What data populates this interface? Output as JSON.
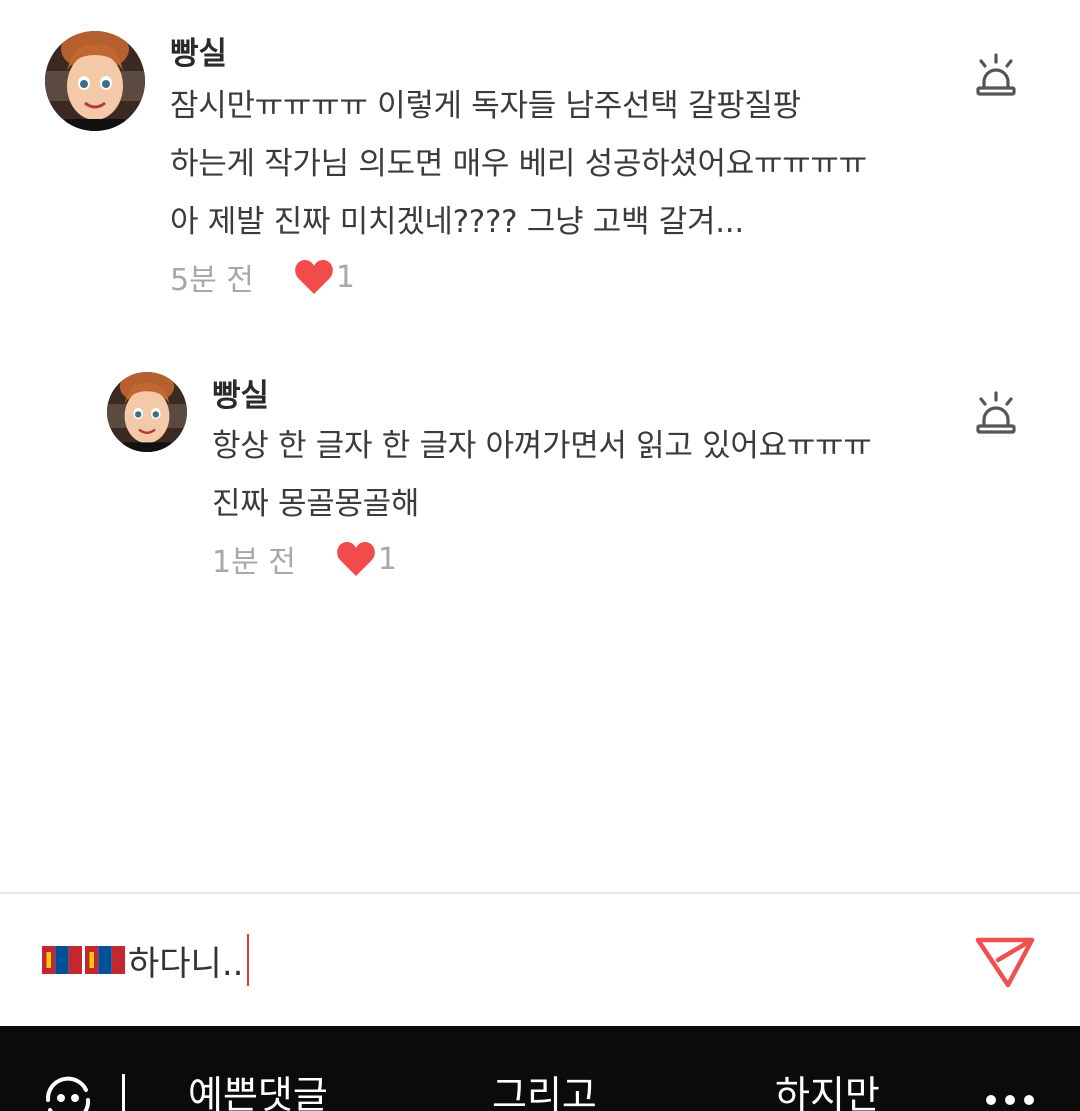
{
  "comments": [
    {
      "username": "빵실",
      "lines": [
        "잠시만ㅠㅠㅠㅠ 이렇게 독자들 남주선택 갈팡질팡",
        "하는게 작가님 의도면 매우 베리 성공하셨어요ㅠㅠㅠㅠ",
        "아 제발 진짜 미치겠네???? 그냥 고백 갈겨..."
      ],
      "time": "5분 전",
      "likes": "1"
    },
    {
      "username": "빵실",
      "lines": [
        "항상 한 글자 한 글자 아껴가면서 읽고 있어요ㅠㅠㅠ",
        "진짜 몽골몽골해"
      ],
      "time": "1분 전",
      "likes": "1"
    }
  ],
  "composer": {
    "input_text": "하다니..",
    "flag_emoji": "mongolia-flag"
  },
  "keyboard": {
    "suggestions": [
      "예쁜댓글",
      "그리고",
      "하지만"
    ]
  },
  "colors": {
    "heart": "#f24b4b",
    "send": "#f0504f",
    "meta_text": "#a8a8a8"
  }
}
